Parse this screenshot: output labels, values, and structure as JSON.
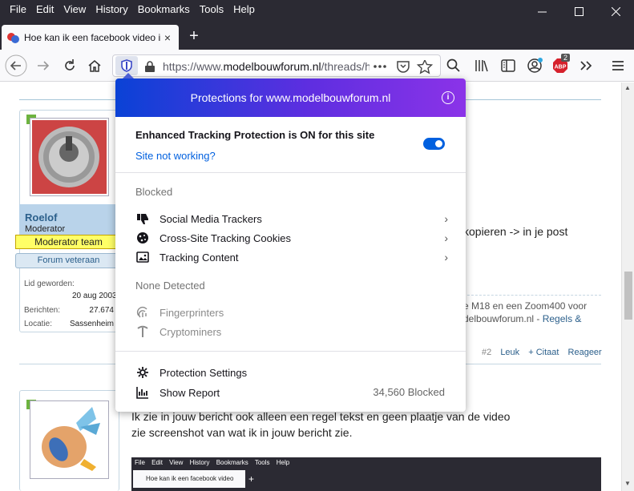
{
  "menu": [
    "File",
    "Edit",
    "View",
    "History",
    "Bookmarks",
    "Tools",
    "Help"
  ],
  "tab": {
    "title": "Hoe kan ik een facebook video in de post plaatsen",
    "close": "×"
  },
  "newtab": "+",
  "url": {
    "prefix": "https://www.",
    "domain": "modelbouwforum.nl",
    "suffix": "/threads/hoe-kan-ik"
  },
  "abp_badge": "2",
  "panel": {
    "title": "Protections for www.modelbouwforum.nl",
    "info": "i",
    "etp_title": "Enhanced Tracking Protection is ON for this site",
    "site_not_working": "Site not working?",
    "blocked_heading": "Blocked",
    "blocked": [
      {
        "label": "Social Media Trackers",
        "icon": "thumbs-down-icon"
      },
      {
        "label": "Cross-Site Tracking Cookies",
        "icon": "cookie-icon"
      },
      {
        "label": "Tracking Content",
        "icon": "image-icon"
      }
    ],
    "none_heading": "None Detected",
    "none": [
      {
        "label": "Fingerprinters",
        "icon": "fingerprint-icon"
      },
      {
        "label": "Cryptominers",
        "icon": "pickaxe-icon"
      }
    ],
    "settings_label": "Protection Settings",
    "report_label": "Show Report",
    "report_count": "34,560 Blocked"
  },
  "post1": {
    "user": "Roelof",
    "role": "Moderator",
    "badge_team": "Moderator team",
    "badge_vet": "Forum veteraan",
    "stats": [
      {
        "k": "Lid geworden:",
        "v": ""
      },
      {
        "k": "",
        "v": "20 aug 2003"
      },
      {
        "k": "Berichten:",
        "v": "27.674"
      },
      {
        "k": "Locatie:",
        "v": "Sassenheim"
      }
    ],
    "text_fragment": "kopieren -> in je post",
    "sig1": "e M18 en een Zoom400 voor",
    "sig2a": "delbouwforum.nl - ",
    "sig2b": "Regels &",
    "post_num": "#2",
    "actions": [
      "Leuk",
      "+ Citaat",
      "Reageer"
    ]
  },
  "post2": {
    "line1": "Ik zie in jouw bericht ook alleen een regel tekst en geen plaatje van de video",
    "line2": "zie screenshot van wat ik in jouw bericht zie.",
    "shot_menu": [
      "File",
      "Edit",
      "View",
      "History",
      "Bookmarks",
      "Tools",
      "Help"
    ],
    "shot_tab": "Hoe kan ik een facebook video",
    "shot_plus": "+"
  }
}
